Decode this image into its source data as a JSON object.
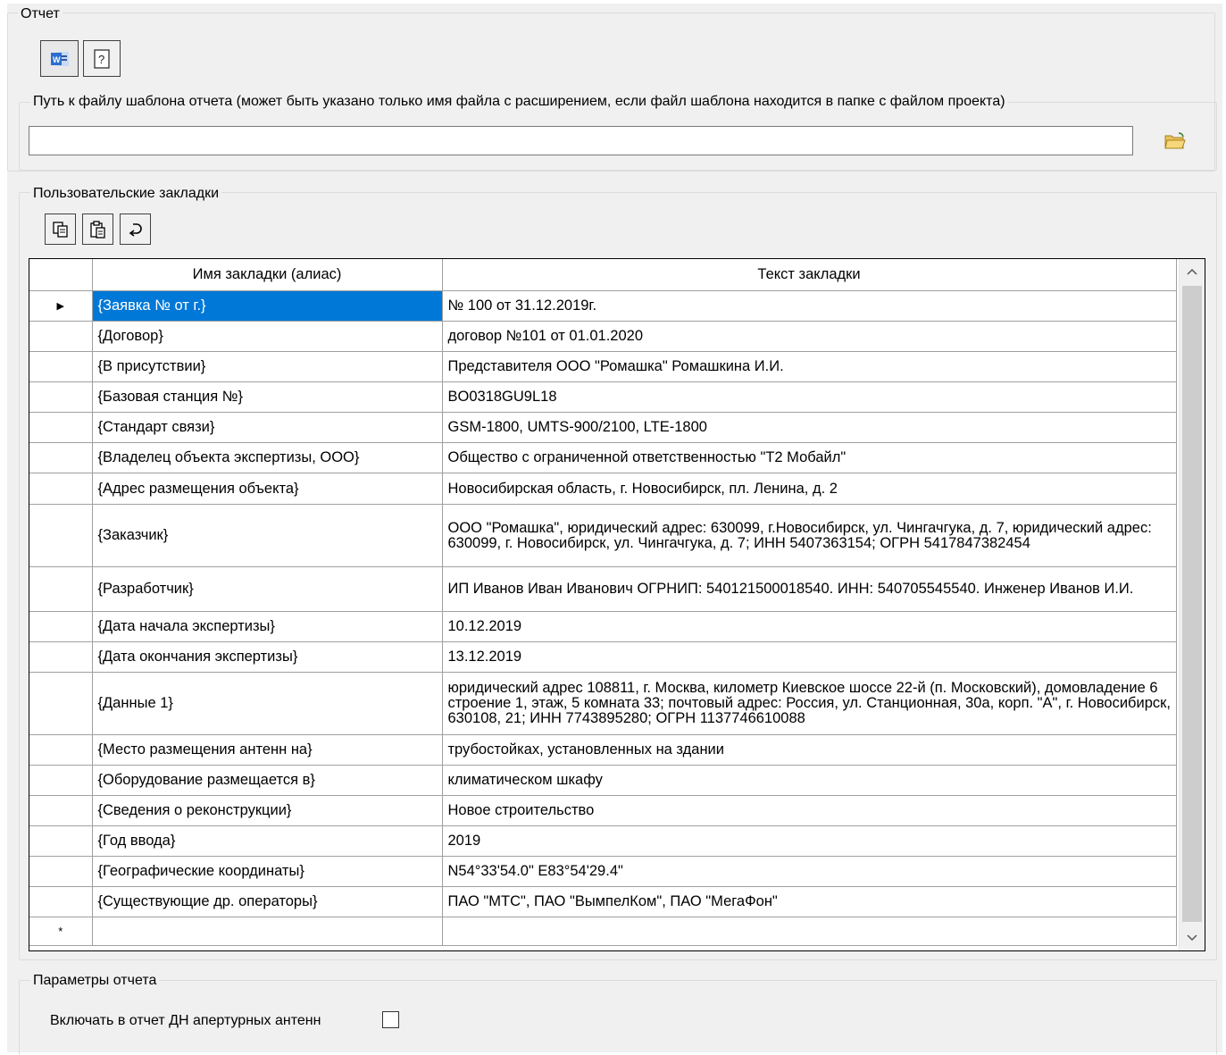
{
  "report_group": {
    "legend": "Отчет",
    "word_button_icon": "word-icon",
    "help_button_icon": "help-icon",
    "template_path_label": "Путь к файлу шаблона отчета (может быть указано только имя файла с расширением, если файл шаблона находится в папке с файлом проекта)",
    "template_path_value": "",
    "browse_button_icon": "open-folder-icon"
  },
  "bookmarks_group": {
    "legend": "Пользовательские закладки",
    "toolbar": [
      {
        "name": "copy-button",
        "icon": "copy-icon"
      },
      {
        "name": "paste-button",
        "icon": "paste-icon"
      },
      {
        "name": "reset-button",
        "icon": "undo-icon"
      }
    ],
    "columns": [
      "Имя закладки (алиас)",
      "Текст закладки"
    ],
    "rows": [
      {
        "alias": "{Заявка № от г.}",
        "text": "№ 100 от 31.12.2019г."
      },
      {
        "alias": "{Договор}",
        "text": "договор №101 от 01.01.2020"
      },
      {
        "alias": "{В присутствии}",
        "text": "Представителя ООО \"Ромашка\" Ромашкина И.И."
      },
      {
        "alias": "{Базовая станция №}",
        "text": "BO0318GU9L18"
      },
      {
        "alias": "{Стандарт связи}",
        "text": "GSM-1800, UMTS-900/2100, LTE-1800"
      },
      {
        "alias": "{Владелец объекта экспертизы, ООО}",
        "text": "Общество с ограниченной ответственностью \"Т2 Мобайл\""
      },
      {
        "alias": "{Адрес размещения объекта}",
        "text": "Новосибирская область, г. Новосибирск, пл. Ленина, д. 2"
      },
      {
        "alias": "{Заказчик}",
        "text": "ООО \"Ромашка\", юридический адрес: 630099, г.Новосибирск, ул. Чингачгука, д. 7, юридический адрес: 630099, г. Новосибирск, ул. Чингачгука, д. 7; ИНН 5407363154; ОГРН 5417847382454"
      },
      {
        "alias": "{Разработчик}",
        "text": "ИП Иванов Иван Иванович ОГРНИП: 540121500018540. ИНН: 540705545540. Инженер Иванов И.И."
      },
      {
        "alias": "{Дата начала экспертизы}",
        "text": "10.12.2019"
      },
      {
        "alias": "{Дата окончания экспертизы}",
        "text": "13.12.2019"
      },
      {
        "alias": "{Данные 1}",
        "text": "юридический адрес 108811, г. Москва, километр Киевское шоссе 22-й (п. Московский), домовладение 6 строение 1, этаж, 5 комната 33; почтовый адрес:  Россия, ул. Станционная, 30а, корп. \"А\", г. Новосибирск, 630108, 21; ИНН 7743895280; ОГРН 1137746610088"
      },
      {
        "alias": "{Место размещения антенн на}",
        "text": "трубостойках, установленных на здании"
      },
      {
        "alias": "{Оборудование размещается в}",
        "text": "климатическом шкафу"
      },
      {
        "alias": "{Сведения о реконструкции}",
        "text": "Новое строительство"
      },
      {
        "alias": "{Год ввода}",
        "text": "2019"
      },
      {
        "alias": "{Географические координаты}",
        "text": "N54°33'54.0\" E83°54'29.4\""
      },
      {
        "alias": "{Существующие др. операторы}",
        "text": "ПАО \"МТС\", ПАО \"ВымпелКом\", ПАО \"МегаФон\""
      }
    ],
    "current_row_marker": "▶",
    "new_row_marker": "*"
  },
  "params_group": {
    "legend": "Параметры отчета",
    "include_apertures_label": "Включать в отчет ДН апертурных антенн",
    "include_apertures_checked": false
  }
}
